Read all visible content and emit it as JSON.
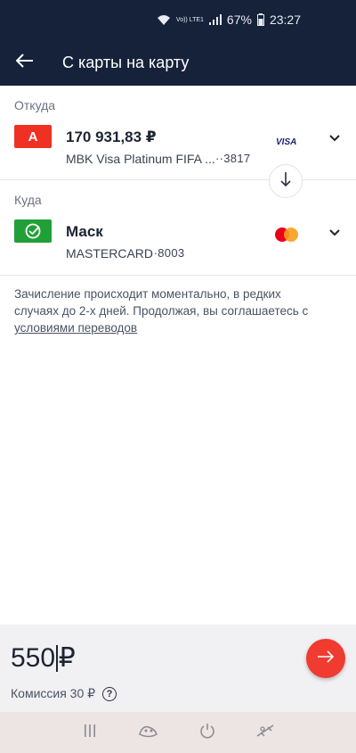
{
  "status": {
    "volte": "Vo)) LTE1",
    "battery": "67%",
    "time": "23:27"
  },
  "header": {
    "title": "С карты на карту"
  },
  "from": {
    "label": "Откуда",
    "amount": "170 931,83 ₽",
    "card_name": "MBK Visa Platinum FIFA ...",
    "card_number": "··3817",
    "brand": "VISA",
    "bank_glyph": "А"
  },
  "to": {
    "label": "Куда",
    "name": "Маск",
    "card_type": "MASTERCARD",
    "card_number": "··8003"
  },
  "info": {
    "text": "Зачисление происходит моментально, в редких случаях до 2-х дней. Продолжая, вы соглашаетесь с",
    "link": "условиями переводов"
  },
  "transfer": {
    "amount": "550",
    "currency": "₽",
    "fee": "Комиссия 30 ₽",
    "help": "?"
  },
  "colors": {
    "header_bg": "#15223a",
    "alfa_red": "#ef3124",
    "sber_green": "#21a038",
    "submit_red": "#ef3b30"
  }
}
